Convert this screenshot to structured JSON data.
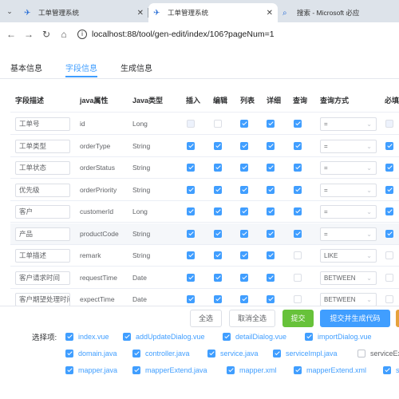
{
  "browser": {
    "tabs": [
      {
        "label": "工单管理系统",
        "icon": "plane-icon",
        "active": false
      },
      {
        "label": "工单管理系统",
        "icon": "plane-icon",
        "active": true
      },
      {
        "label": "搜索 - Microsoft 必应",
        "icon": "search-icon",
        "active": false
      }
    ],
    "close_glyph": "✕",
    "url": "localhost:88/tool/gen-edit/index/106?pageNum=1"
  },
  "page_tabs": [
    "基本信息",
    "字段信息",
    "生成信息"
  ],
  "active_page_tab": 1,
  "table": {
    "headers": [
      "字段描述",
      "java属性",
      "Java类型",
      "插入",
      "编辑",
      "列表",
      "详细",
      "查询",
      "查询方式",
      "必填"
    ],
    "rows": [
      {
        "desc": "工单号",
        "attr": "id",
        "type": "Long",
        "insert": "disabled",
        "edit": "off",
        "list": "on",
        "detail": "on",
        "query": "on",
        "mode": "=",
        "required": "disabled"
      },
      {
        "desc": "工单类型",
        "attr": "orderType",
        "type": "String",
        "insert": "on",
        "edit": "on",
        "list": "on",
        "detail": "on",
        "query": "on",
        "mode": "=",
        "required": "on"
      },
      {
        "desc": "工单状态",
        "attr": "orderStatus",
        "type": "String",
        "insert": "on",
        "edit": "on",
        "list": "on",
        "detail": "on",
        "query": "on",
        "mode": "=",
        "required": "on"
      },
      {
        "desc": "优先级",
        "attr": "orderPriority",
        "type": "String",
        "insert": "on",
        "edit": "on",
        "list": "on",
        "detail": "on",
        "query": "on",
        "mode": "=",
        "required": "on"
      },
      {
        "desc": "客户",
        "attr": "customerId",
        "type": "Long",
        "insert": "on",
        "edit": "on",
        "list": "on",
        "detail": "on",
        "query": "on",
        "mode": "=",
        "required": "on"
      },
      {
        "desc": "产品",
        "attr": "productCode",
        "type": "String",
        "insert": "on",
        "edit": "on",
        "list": "on",
        "detail": "on",
        "query": "on",
        "mode": "=",
        "required": "on"
      },
      {
        "desc": "工单描述",
        "attr": "remark",
        "type": "String",
        "insert": "on",
        "edit": "on",
        "list": "on",
        "detail": "on",
        "query": "off",
        "mode": "LIKE",
        "required": "off"
      },
      {
        "desc": "客户请求时间",
        "attr": "requestTime",
        "type": "Date",
        "insert": "on",
        "edit": "on",
        "list": "on",
        "detail": "on",
        "query": "off",
        "mode": "BETWEEN",
        "required": "off"
      },
      {
        "desc": "客户期望处理时间",
        "attr": "expectTime",
        "type": "Date",
        "insert": "on",
        "edit": "on",
        "list": "on",
        "detail": "on",
        "query": "off",
        "mode": "BETWEEN",
        "required": "off"
      }
    ]
  },
  "footer": {
    "select_all": "全选",
    "deselect_all": "取消全选",
    "submit": "提交",
    "submit_generate": "提交并生成代码",
    "options_label": "选择项:",
    "options": [
      {
        "label": "index.vue",
        "checked": true
      },
      {
        "label": "addUpdateDialog.vue",
        "checked": true
      },
      {
        "label": "detailDialog.vue",
        "checked": true
      },
      {
        "label": "importDialog.vue",
        "checked": true
      },
      {
        "label": "domain.java",
        "checked": true
      },
      {
        "label": "controller.java",
        "checked": true
      },
      {
        "label": "service.java",
        "checked": true
      },
      {
        "label": "serviceImpl.java",
        "checked": true
      },
      {
        "label": "serviceEx",
        "checked": false
      },
      {
        "label": "mapper.java",
        "checked": true
      },
      {
        "label": "mapperExtend.java",
        "checked": true
      },
      {
        "label": "mapper.xml",
        "checked": true
      },
      {
        "label": "mapperExtend.xml",
        "checked": true
      },
      {
        "label": "s",
        "checked": true
      }
    ]
  },
  "colors": {
    "primary": "#409eff",
    "success": "#67c23a",
    "warning": "#e6a23c"
  }
}
